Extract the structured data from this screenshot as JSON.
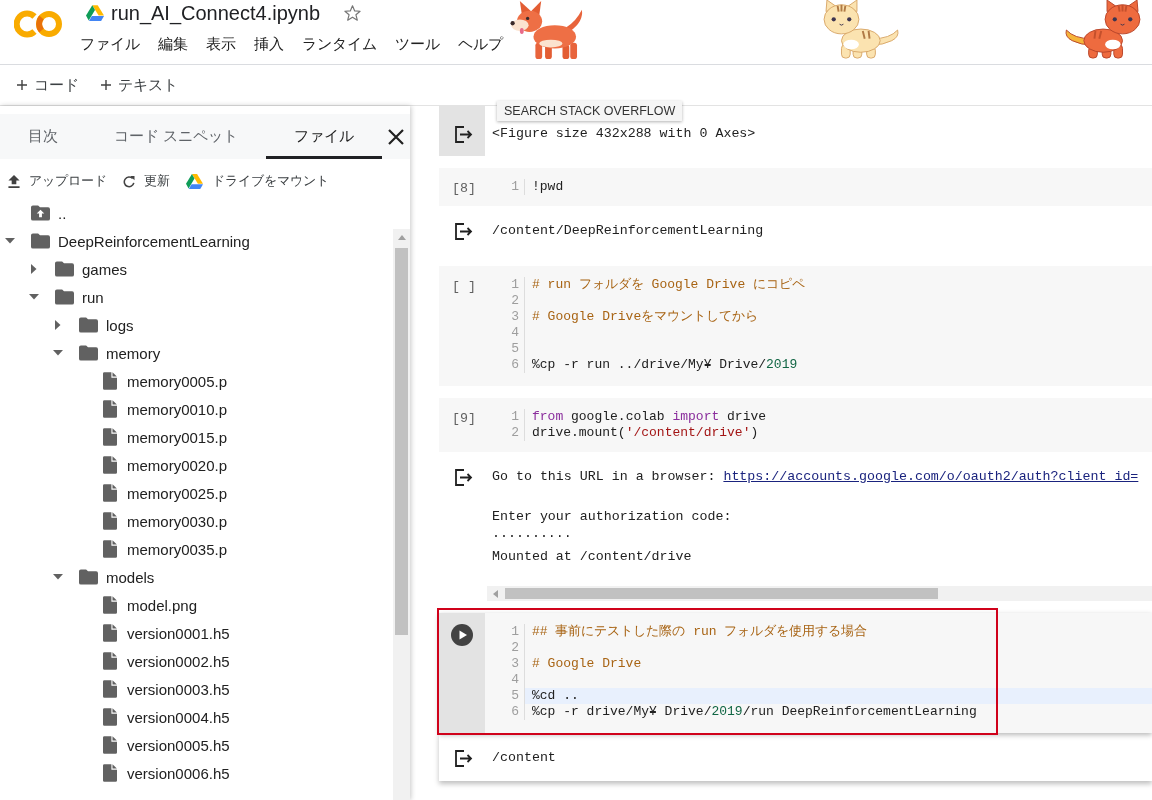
{
  "header": {
    "title": "run_AI_Connect4.ipynb",
    "starred": false,
    "menu": [
      "ファイル",
      "編集",
      "表示",
      "挿入",
      "ランタイム",
      "ツール",
      "ヘルプ"
    ]
  },
  "toolbar": {
    "buttons": [
      "コード",
      "テキスト"
    ]
  },
  "sidebar": {
    "tabs": [
      {
        "label": "目次",
        "selected": false
      },
      {
        "label": "コード スニペット",
        "selected": false
      },
      {
        "label": "ファイル",
        "selected": true
      }
    ],
    "actions": [
      {
        "kind": "upload",
        "label": "アップロード"
      },
      {
        "kind": "refresh",
        "label": "更新"
      },
      {
        "kind": "drive",
        "label": "ドライブをマウント"
      }
    ],
    "tree": [
      {
        "kind": "parent",
        "name": ".."
      },
      {
        "kind": "folder",
        "name": "DeepReinforcementLearning",
        "expanded": true,
        "children": [
          {
            "kind": "folder",
            "name": "games",
            "expanded": false
          },
          {
            "kind": "folder",
            "name": "run",
            "expanded": true,
            "children": [
              {
                "kind": "folder",
                "name": "logs",
                "expanded": false
              },
              {
                "kind": "folder",
                "name": "memory",
                "expanded": true,
                "children": [
                  {
                    "kind": "file",
                    "name": "memory0005.p"
                  },
                  {
                    "kind": "file",
                    "name": "memory0010.p"
                  },
                  {
                    "kind": "file",
                    "name": "memory0015.p"
                  },
                  {
                    "kind": "file",
                    "name": "memory0020.p"
                  },
                  {
                    "kind": "file",
                    "name": "memory0025.p"
                  },
                  {
                    "kind": "file",
                    "name": "memory0030.p"
                  },
                  {
                    "kind": "file",
                    "name": "memory0035.p"
                  }
                ]
              },
              {
                "kind": "folder",
                "name": "models",
                "expanded": true,
                "children": [
                  {
                    "kind": "file",
                    "name": "model.png"
                  },
                  {
                    "kind": "file",
                    "name": "version0001.h5"
                  },
                  {
                    "kind": "file",
                    "name": "version0002.h5"
                  },
                  {
                    "kind": "file",
                    "name": "version0003.h5"
                  },
                  {
                    "kind": "file",
                    "name": "version0004.h5"
                  },
                  {
                    "kind": "file",
                    "name": "version0005.h5"
                  },
                  {
                    "kind": "file",
                    "name": "version0006.h5"
                  }
                ]
              }
            ]
          }
        ]
      }
    ]
  },
  "notebook": {
    "tooltip": "SEARCH STACK OVERFLOW",
    "cells": [
      {
        "kind": "output",
        "highlighted": true,
        "scrollable": false,
        "blocks": [
          [
            {
              "text": "<Figure size 432x288 with 0 Axes>"
            }
          ]
        ]
      },
      {
        "kind": "code",
        "label": "[8]",
        "selected": false,
        "framed": false,
        "lines": [
          {
            "number": "1",
            "tokens": [
              {
                "kind": "plain",
                "text": "!pwd"
              }
            ]
          }
        ]
      },
      {
        "kind": "output",
        "highlighted": false,
        "scrollable": false,
        "blocks": [
          [
            {
              "text": "/content/DeepReinforcementLearning"
            }
          ]
        ]
      },
      {
        "kind": "code",
        "label": "[ ]",
        "selected": false,
        "framed": false,
        "lines": [
          {
            "number": "1",
            "tokens": [
              {
                "kind": "comment",
                "text": "# run フォルダを Google Drive にコピペ"
              }
            ]
          },
          {
            "number": "2"
          },
          {
            "number": "3",
            "tokens": [
              {
                "kind": "comment",
                "text": "# Google Driveをマウントしてから"
              }
            ]
          },
          {
            "number": "4"
          },
          {
            "number": "5"
          },
          {
            "number": "6",
            "tokens": [
              {
                "kind": "plain",
                "text": "%cp -r run ../drive/My¥ Drive/"
              },
              {
                "kind": "number",
                "text": "2019"
              }
            ]
          }
        ]
      },
      {
        "kind": "code",
        "label": "[9]",
        "selected": false,
        "framed": false,
        "lines": [
          {
            "number": "1",
            "tokens": [
              {
                "kind": "keyword",
                "text": "from"
              },
              {
                "kind": "plain",
                "text": " google.colab "
              },
              {
                "kind": "keyword",
                "text": "import"
              },
              {
                "kind": "plain",
                "text": " drive"
              }
            ]
          },
          {
            "number": "2",
            "tokens": [
              {
                "kind": "plain",
                "text": "drive.mount("
              },
              {
                "kind": "string",
                "text": "'/content/drive'"
              },
              {
                "kind": "plain",
                "text": ")"
              }
            ]
          }
        ]
      },
      {
        "kind": "output",
        "highlighted": false,
        "scrollable": true,
        "blocks": [
          [
            {
              "text": "Go to this URL in a browser:",
              "link": "https://accounts.google.com/o/oauth2/auth?client_id="
            }
          ],
          [
            {
              "text": "Enter your authorization code:"
            },
            {
              "text": "··········"
            },
            {
              "text": "Mounted at /content/drive"
            }
          ]
        ]
      },
      {
        "kind": "code",
        "selected": true,
        "framed": true,
        "lines": [
          {
            "number": "1",
            "current": false,
            "tokens": [
              {
                "kind": "comment",
                "text": "## 事前にテストした際の run フォルダを使用する場合"
              }
            ]
          },
          {
            "number": "2",
            "current": false
          },
          {
            "number": "3",
            "current": false,
            "tokens": [
              {
                "kind": "comment",
                "text": "# Google Drive"
              }
            ]
          },
          {
            "number": "4",
            "current": false
          },
          {
            "number": "5",
            "current": true,
            "tokens": [
              {
                "kind": "plain",
                "text": "%cd .."
              }
            ]
          },
          {
            "number": "6",
            "current": false,
            "tokens": [
              {
                "kind": "plain",
                "text": "%cp -r drive/My¥ Drive/"
              },
              {
                "kind": "number",
                "text": "2019"
              },
              {
                "kind": "plain",
                "text": "/run DeepReinforcementLearning"
              }
            ]
          }
        ]
      },
      {
        "kind": "output",
        "highlighted": false,
        "scrollable": false,
        "blocks": [
          [
            {
              "text": "/content"
            }
          ]
        ]
      }
    ]
  }
}
